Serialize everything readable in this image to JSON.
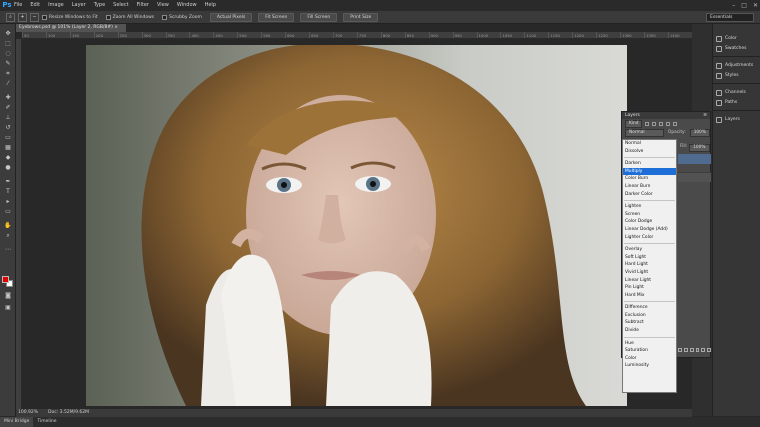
{
  "app": {
    "logo": "Ps"
  },
  "menu": [
    "File",
    "Edit",
    "Image",
    "Layer",
    "Type",
    "Select",
    "Filter",
    "View",
    "Window",
    "Help"
  ],
  "window_controls": [
    "–",
    "□",
    "✕"
  ],
  "options": {
    "checkbox1": "Resize Windows to Fit",
    "checkbox2": "Zoom All Windows",
    "checkbox3": "Scrubby Zoom",
    "btn_actual": "Actual Pixels",
    "btn_fit": "Fit Screen",
    "btn_fill": "Fill Screen",
    "btn_print": "Print Size",
    "workspace": "Essentials"
  },
  "document": {
    "tab_title": "Eyebrows.psd @ 101% (Layer 2, RGB/8#) ×",
    "ruler_ticks": [
      "50",
      "100",
      "150",
      "200",
      "250",
      "300",
      "350",
      "400",
      "450",
      "500",
      "550",
      "600",
      "650",
      "700",
      "750",
      "800",
      "850",
      "900",
      "950",
      "1000",
      "1050",
      "1100",
      "1150",
      "1200",
      "1250",
      "1300",
      "1350",
      "1400"
    ],
    "zoom": "100.92%",
    "doc_size": "Doc: 3.52M/9.62M"
  },
  "bottom_tabs": [
    "Mini Bridge",
    "Timeline"
  ],
  "dock": {
    "items": [
      {
        "label": "Color",
        "icon": "color-icon"
      },
      {
        "label": "Swatches",
        "icon": "swatches-icon"
      },
      {
        "label": "Adjustments",
        "icon": "adjustments-icon"
      },
      {
        "label": "Styles",
        "icon": "styles-icon"
      },
      {
        "label": "Channels",
        "icon": "channels-icon"
      },
      {
        "label": "Paths",
        "icon": "paths-icon"
      },
      {
        "label": "Layers",
        "icon": "layers-icon"
      }
    ]
  },
  "layers_panel": {
    "title": "Layers",
    "kind": "Kind",
    "blend_value": "Normal",
    "opacity_label": "Opacity:",
    "opacity_value": "100%",
    "fill_label": "Fill:",
    "fill_value": "100%"
  },
  "blend_modes": [
    [
      "Normal",
      "Dissolve"
    ],
    [
      "Darken",
      "Multiply",
      "Color Burn",
      "Linear Burn",
      "Darker Color"
    ],
    [
      "Lighten",
      "Screen",
      "Color Dodge",
      "Linear Dodge (Add)",
      "Lighter Color"
    ],
    [
      "Overlay",
      "Soft Light",
      "Hard Light",
      "Vivid Light",
      "Linear Light",
      "Pin Light",
      "Hard Mix"
    ],
    [
      "Difference",
      "Exclusion",
      "Subtract",
      "Divide"
    ],
    [
      "Hue",
      "Saturation",
      "Color",
      "Luminosity"
    ]
  ],
  "blend_selected": "Multiply",
  "colors": {
    "foreground": "#e00000",
    "background": "#ffffff",
    "highlight": "#1d6ed6"
  }
}
